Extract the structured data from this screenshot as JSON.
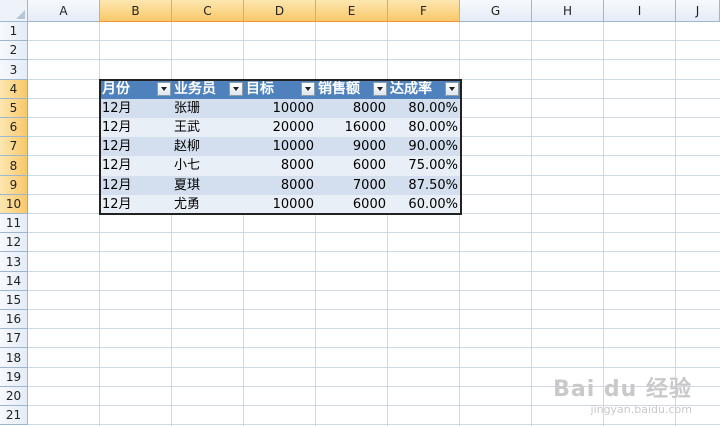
{
  "sheet": {
    "columns": [
      "A",
      "B",
      "C",
      "D",
      "E",
      "F",
      "G",
      "H",
      "I",
      "J"
    ],
    "rows": [
      "1",
      "2",
      "3",
      "4",
      "5",
      "6",
      "7",
      "8",
      "9",
      "10",
      "11",
      "12",
      "13",
      "14",
      "15",
      "16",
      "17",
      "18",
      "19",
      "20",
      "21"
    ]
  },
  "table": {
    "headers": [
      "月份",
      "业务员",
      "目标",
      "销售额",
      "达成率"
    ],
    "rows": [
      [
        "12月",
        "张珊",
        "10000",
        "8000",
        "80.00%"
      ],
      [
        "12月",
        "王武",
        "20000",
        "16000",
        "80.00%"
      ],
      [
        "12月",
        "赵柳",
        "10000",
        "9000",
        "90.00%"
      ],
      [
        "12月",
        "小七",
        "8000",
        "6000",
        "75.00%"
      ],
      [
        "12月",
        "夏琪",
        "8000",
        "7000",
        "87.50%"
      ],
      [
        "12月",
        "尤勇",
        "10000",
        "6000",
        "60.00%"
      ]
    ]
  },
  "watermark": {
    "main": "Bai du 经验",
    "sub": "jingyan.baidu.com"
  },
  "colors": {
    "header_fill": "#4f81bd",
    "band_dark": "#d3dfee",
    "band_light": "#e9eff7",
    "selected_header": "#f8c86a",
    "grid": "#d0d7e5"
  }
}
